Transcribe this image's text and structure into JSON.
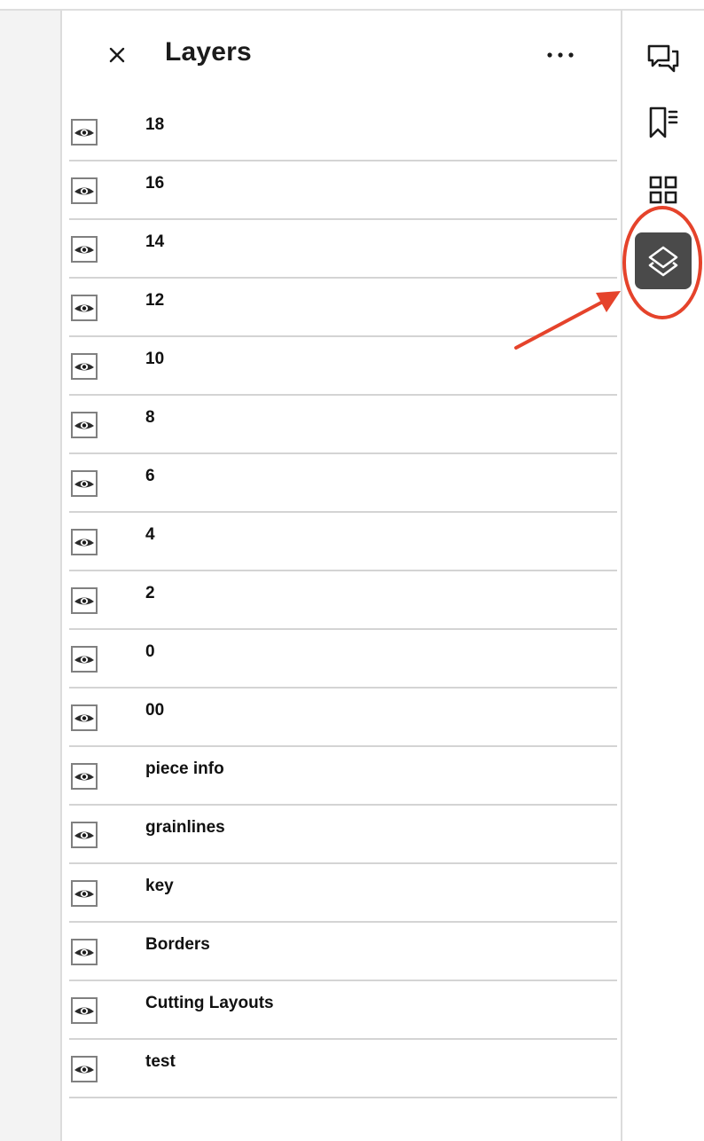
{
  "panel": {
    "title": "Layers",
    "close_icon": "close-icon",
    "more_icon": "more-horizontal-icon"
  },
  "layers": [
    {
      "name": "18",
      "icon": "eye-icon"
    },
    {
      "name": "16",
      "icon": "eye-icon"
    },
    {
      "name": "14",
      "icon": "eye-icon"
    },
    {
      "name": "12",
      "icon": "eye-icon"
    },
    {
      "name": "10",
      "icon": "eye-icon"
    },
    {
      "name": "8",
      "icon": "eye-icon"
    },
    {
      "name": "6",
      "icon": "eye-icon"
    },
    {
      "name": "4",
      "icon": "eye-icon"
    },
    {
      "name": "2",
      "icon": "eye-icon"
    },
    {
      "name": "0",
      "icon": "eye-icon"
    },
    {
      "name": "00",
      "icon": "eye-icon"
    },
    {
      "name": "piece info",
      "icon": "eye-icon"
    },
    {
      "name": "grainlines",
      "icon": "eye-icon"
    },
    {
      "name": "key",
      "icon": "eye-icon"
    },
    {
      "name": "Borders",
      "icon": "eye-icon"
    },
    {
      "name": "Cutting Layouts",
      "icon": "eye-icon"
    },
    {
      "name": "test",
      "icon": "eye-icon"
    }
  ],
  "right_rail": [
    {
      "icon": "comments-icon",
      "active": false
    },
    {
      "icon": "bookmarks-icon",
      "active": false
    },
    {
      "icon": "thumbnails-icon",
      "active": false
    },
    {
      "icon": "layers-icon",
      "active": true
    }
  ],
  "colors": {
    "annotation": "#e5432b",
    "active_rail_bg": "#4a4a4a",
    "divider": "#d4d4d4"
  }
}
